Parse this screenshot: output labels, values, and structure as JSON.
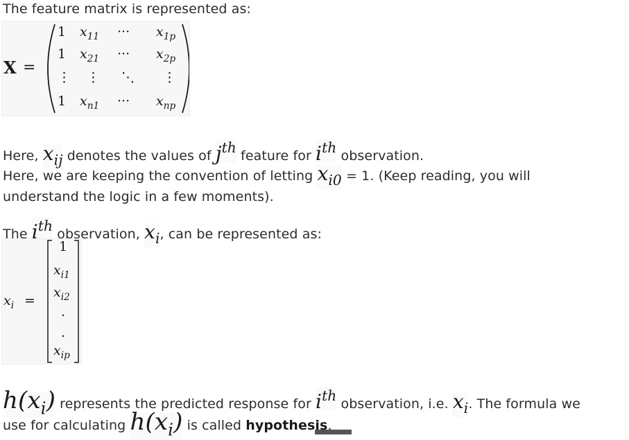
{
  "intro": "The feature matrix is represented as:",
  "matrix_X": {
    "lhs": "X =",
    "rows": [
      [
        "1",
        "x11",
        "···",
        "x1p"
      ],
      [
        "1",
        "x21",
        "···",
        "x2p"
      ],
      [
        "⋮",
        "⋮",
        "⋱",
        "⋮"
      ],
      [
        "1",
        "xn1",
        "···",
        "xnp"
      ]
    ]
  },
  "para1": {
    "a": "Here, ",
    "xij": "x",
    "xij_sub": "ij",
    "b": " denotes the values of ",
    "j": "j",
    "j_sup": "th",
    "c": " feature for ",
    "i": "i",
    "i_sup": "th",
    "d": " observation."
  },
  "para2": {
    "a": "Here, we are keeping the convention of letting ",
    "x": "x",
    "x_sub": "i0",
    "b": " = 1. (Keep reading, you will",
    "line2": "understand the logic in a few moments)."
  },
  "para3": {
    "a": "The ",
    "i": "i",
    "i_sup": "th",
    "b": " observation, ",
    "x": "x",
    "x_sub": "i",
    "c": ", can be represented as:"
  },
  "vector_xi": {
    "lhs": "xi =",
    "entries": [
      "1",
      "xi1",
      "xi2",
      ".",
      ".",
      "xip"
    ]
  },
  "para4": {
    "h1": "h(x",
    "h1_sub": "i",
    "h1_close": ")",
    "a": " represents the predicted response for ",
    "i": "i",
    "i_sup": "th",
    "b": " observation, i.e. ",
    "x": "x",
    "x_sub": "i",
    "c": ". The formula we",
    "d": "use for calculating ",
    "h2": "h(x",
    "h2_sub": "i",
    "h2_close": ")",
    "e": " is called ",
    "bold": "hypothesis",
    "f": "."
  }
}
